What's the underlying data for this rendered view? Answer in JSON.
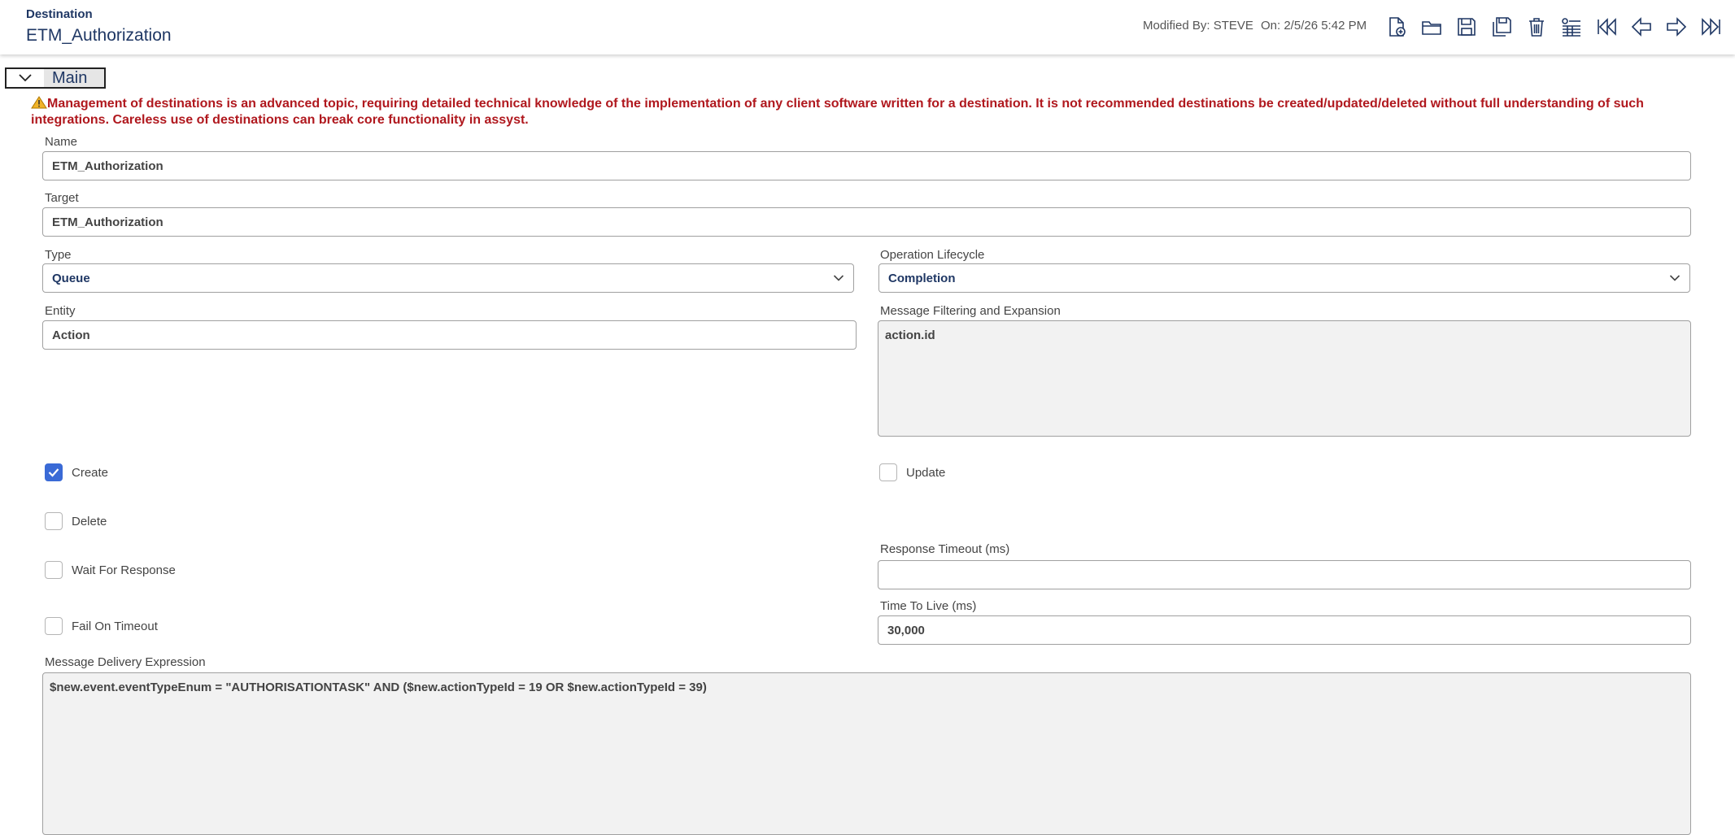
{
  "header": {
    "subtitle": "Destination",
    "title": "ETM_Authorization",
    "modified_by": "Modified By: STEVE",
    "modified_on": "On: 2/5/26 5:42 PM"
  },
  "toolbar": {
    "icons": [
      "new-record-icon",
      "open-folder-icon",
      "save-icon",
      "save-copy-icon",
      "delete-icon",
      "list-view-icon",
      "first-record-icon",
      "previous-record-icon",
      "next-record-icon",
      "last-record-icon"
    ]
  },
  "section": {
    "label": "Main"
  },
  "warning": {
    "text": "Management of destinations is an advanced topic, requiring detailed technical knowledge of the implementation of any client software written for a destination. It is not recommended destinations be created/updated/deleted without full understanding of such integrations. Careless use of destinations can break core functionality in assyst."
  },
  "form": {
    "name": {
      "label": "Name",
      "value": "ETM_Authorization"
    },
    "target": {
      "label": "Target",
      "value": "ETM_Authorization"
    },
    "type": {
      "label": "Type",
      "value": "Queue"
    },
    "operation_lifecycle": {
      "label": "Operation Lifecycle",
      "value": "Completion"
    },
    "entity": {
      "label": "Entity",
      "value": "Action"
    },
    "message_filtering": {
      "label": "Message Filtering and Expansion",
      "value": "action.id"
    },
    "create": {
      "label": "Create",
      "checked": true
    },
    "update": {
      "label": "Update",
      "checked": false
    },
    "delete": {
      "label": "Delete",
      "checked": false
    },
    "wait_for_response": {
      "label": "Wait For Response",
      "checked": false
    },
    "response_timeout": {
      "label": "Response Timeout (ms)",
      "value": ""
    },
    "fail_on_timeout": {
      "label": "Fail On Timeout",
      "checked": false
    },
    "time_to_live": {
      "label": "Time To Live (ms)",
      "value": "30,000"
    },
    "message_delivery": {
      "label": "Message Delivery Expression",
      "value": "$new.event.eventTypeEnum = \"AUTHORISATIONTASK\" AND ($new.actionTypeId = 19 OR $new.actionTypeId = 39)"
    }
  },
  "colors": {
    "brand_navy": "#1f3764",
    "warning_red": "#b0181e",
    "checkbox_blue": "#3a6ad6"
  }
}
